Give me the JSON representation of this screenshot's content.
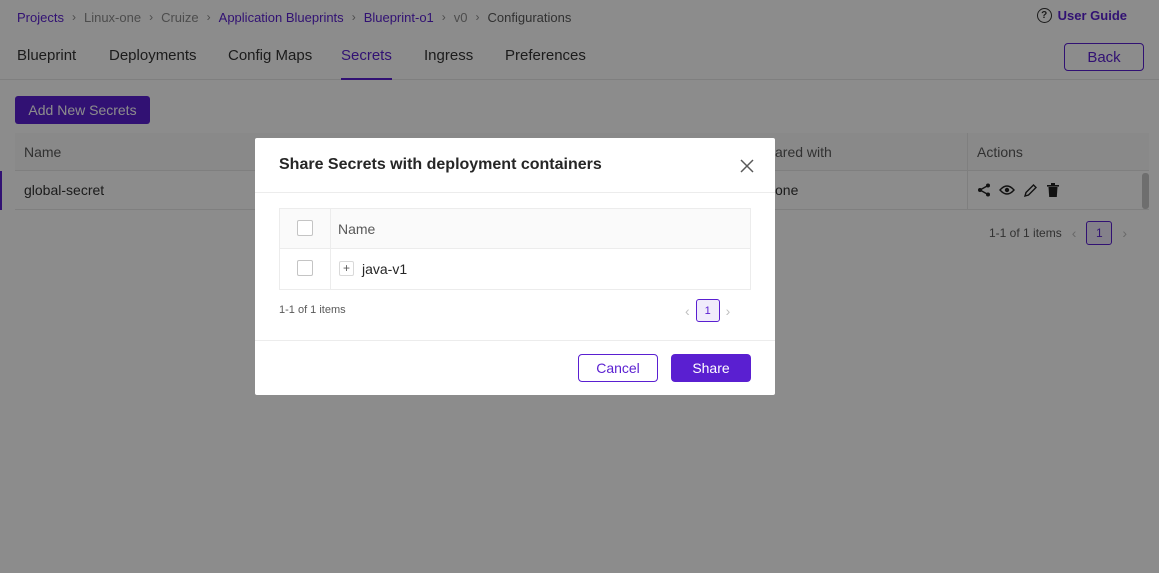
{
  "breadcrumb": [
    {
      "label": "Projects",
      "style": "link"
    },
    {
      "label": "Linux-one",
      "style": "plain"
    },
    {
      "label": "Cruize",
      "style": "plain"
    },
    {
      "label": "Application Blueprints",
      "style": "link"
    },
    {
      "label": "Blueprint-o1",
      "style": "link"
    },
    {
      "label": "v0",
      "style": "plain"
    },
    {
      "label": "Configurations",
      "style": "current"
    }
  ],
  "header": {
    "user_guide": "User Guide",
    "help_icon": "?"
  },
  "tabs": [
    {
      "label": "Blueprint"
    },
    {
      "label": "Deployments"
    },
    {
      "label": "Config Maps"
    },
    {
      "label": "Secrets",
      "active": true
    },
    {
      "label": "Ingress"
    },
    {
      "label": "Preferences"
    }
  ],
  "back_label": "Back",
  "add_button": "Add New Secrets",
  "table": {
    "columns": {
      "name": "Name",
      "shared_with": "ared with",
      "actions": "Actions"
    },
    "rows": [
      {
        "name": "global-secret",
        "shared_with": "one"
      }
    ],
    "action_icons": [
      "share-icon",
      "eye-icon",
      "pencil-icon",
      "trash-icon"
    ],
    "pagination": {
      "info": "1-1 of 1 items",
      "page": "1"
    }
  },
  "modal": {
    "title": "Share Secrets with deployment containers",
    "table": {
      "column_name": "Name",
      "rows": [
        {
          "name": "java-v1",
          "expand": "+"
        }
      ]
    },
    "pagination": {
      "info": "1-1 of 1 items",
      "page": "1"
    },
    "cancel": "Cancel",
    "share": "Share"
  },
  "colors": {
    "accent": "#5a1fd1",
    "overlay": "rgba(0,0,0,0.45)"
  }
}
